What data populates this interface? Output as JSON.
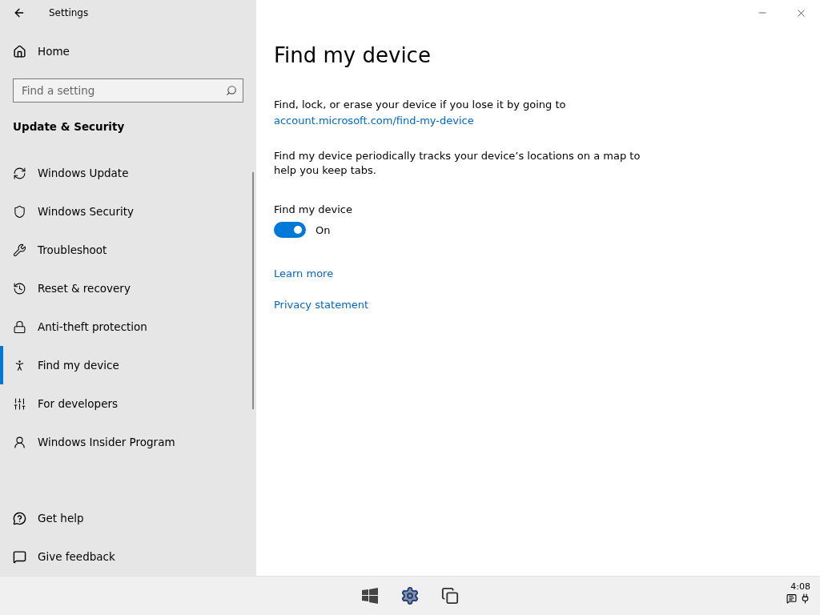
{
  "window": {
    "title": "Settings"
  },
  "sidebar": {
    "home": "Home",
    "search": {
      "placeholder": "Find a setting"
    },
    "section": "Update & Security",
    "items": [
      {
        "label": "Windows Update",
        "selected": false
      },
      {
        "label": "Windows Security",
        "selected": false
      },
      {
        "label": "Troubleshoot",
        "selected": false
      },
      {
        "label": "Reset & recovery",
        "selected": false
      },
      {
        "label": "Anti-theft protection",
        "selected": false
      },
      {
        "label": "Find my device",
        "selected": true
      },
      {
        "label": "For developers",
        "selected": false
      },
      {
        "label": "Windows Insider Program",
        "selected": false
      }
    ],
    "footer": [
      "Get help",
      "Give feedback"
    ]
  },
  "main": {
    "title": "Find my device",
    "intro": "Find, lock, or erase your device if you lose it by going to",
    "intro_link": "account.microsoft.com/find-my-device",
    "description": "Find my device periodically tracks your device’s locations on a map to help you keep tabs.",
    "toggle": {
      "label": "Find my device",
      "on": true,
      "state_text": "On"
    },
    "links": [
      "Learn more",
      "Privacy statement"
    ]
  },
  "taskbar": {
    "time": "4:08"
  }
}
